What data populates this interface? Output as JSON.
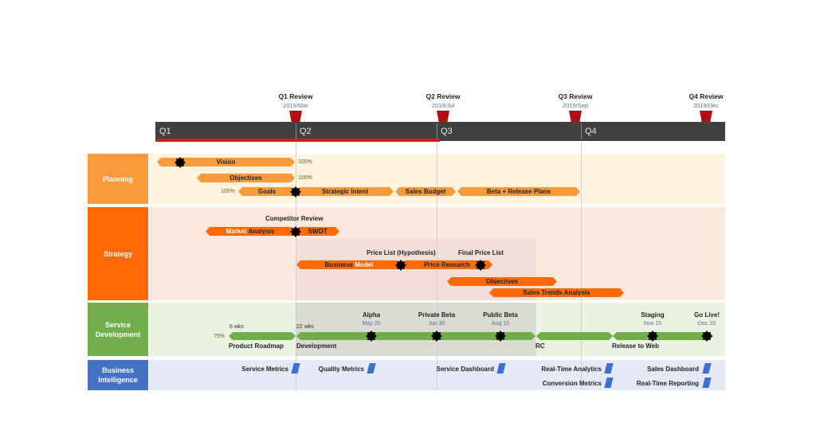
{
  "timeline": {
    "quarters": [
      "Q1",
      "Q2",
      "Q3",
      "Q4"
    ],
    "progress_through": "Q3 start",
    "colors": {
      "bar": "#404040",
      "progress": "#cc1c1c",
      "milestone_flag": "#b01015"
    }
  },
  "reviews": [
    {
      "title": "Q1 Review",
      "date": "2019/Mar"
    },
    {
      "title": "Q2 Review",
      "date": "2019/Jul"
    },
    {
      "title": "Q3 Review",
      "date": "2019/Sep"
    },
    {
      "title": "Q4 Review",
      "date": "2019/Dec"
    }
  ],
  "lanes": {
    "planning": {
      "label": "Planning",
      "color": "#fb9a3a",
      "bg": "#fff4df",
      "tasks": [
        {
          "label": "Vision",
          "percent": "100%"
        },
        {
          "label": "Objectives",
          "percent": "100%"
        },
        {
          "label": "Goals",
          "percent": "100%"
        },
        {
          "label": "Strategic Intent"
        },
        {
          "label": "Sales Budget"
        },
        {
          "label": "Beta + Release Plans"
        }
      ]
    },
    "strategy": {
      "label": "Strategy",
      "color": "#ff6a06",
      "bg": "#fbe9de",
      "milestones": [
        "Competitor Review",
        "Price List (Hypothesis)",
        "Final Price List"
      ],
      "tasks": [
        {
          "label_a": "Market",
          "label_b": "Analysis"
        },
        {
          "label": "SWOT"
        },
        {
          "label_a": "Business",
          "label_b": "Model"
        },
        {
          "label": "Price Research"
        },
        {
          "label": "Objectives"
        },
        {
          "label": "Sales Trends Analysis"
        }
      ]
    },
    "service": {
      "label": "Service Development",
      "color": "#6fae48",
      "bg": "#eaf3e1",
      "percent": "75%",
      "durations": [
        "6 wks",
        "22 wks"
      ],
      "phases": [
        "Product Roadmap",
        "Development",
        "RC",
        "Release to Web"
      ],
      "milestones": [
        {
          "title": "Alpha",
          "date": "May 20"
        },
        {
          "title": "Private Beta",
          "date": "Jun 30"
        },
        {
          "title": "Public Beta",
          "date": "Aug 10"
        },
        {
          "title": "Staging",
          "date": "Nov 15"
        },
        {
          "title": "Go Live!",
          "date": "Dec 20"
        }
      ]
    },
    "bi": {
      "label": "Business Intelligence",
      "color": "#4472c4",
      "bg": "#e4e9f5",
      "items": [
        "Service Metrics",
        "Quality Metrics",
        "Service Dashboard",
        "Real-Time Analytics",
        "Conversion Metrics",
        "Sales Dashboard",
        "Real-Time Reporting"
      ]
    }
  }
}
